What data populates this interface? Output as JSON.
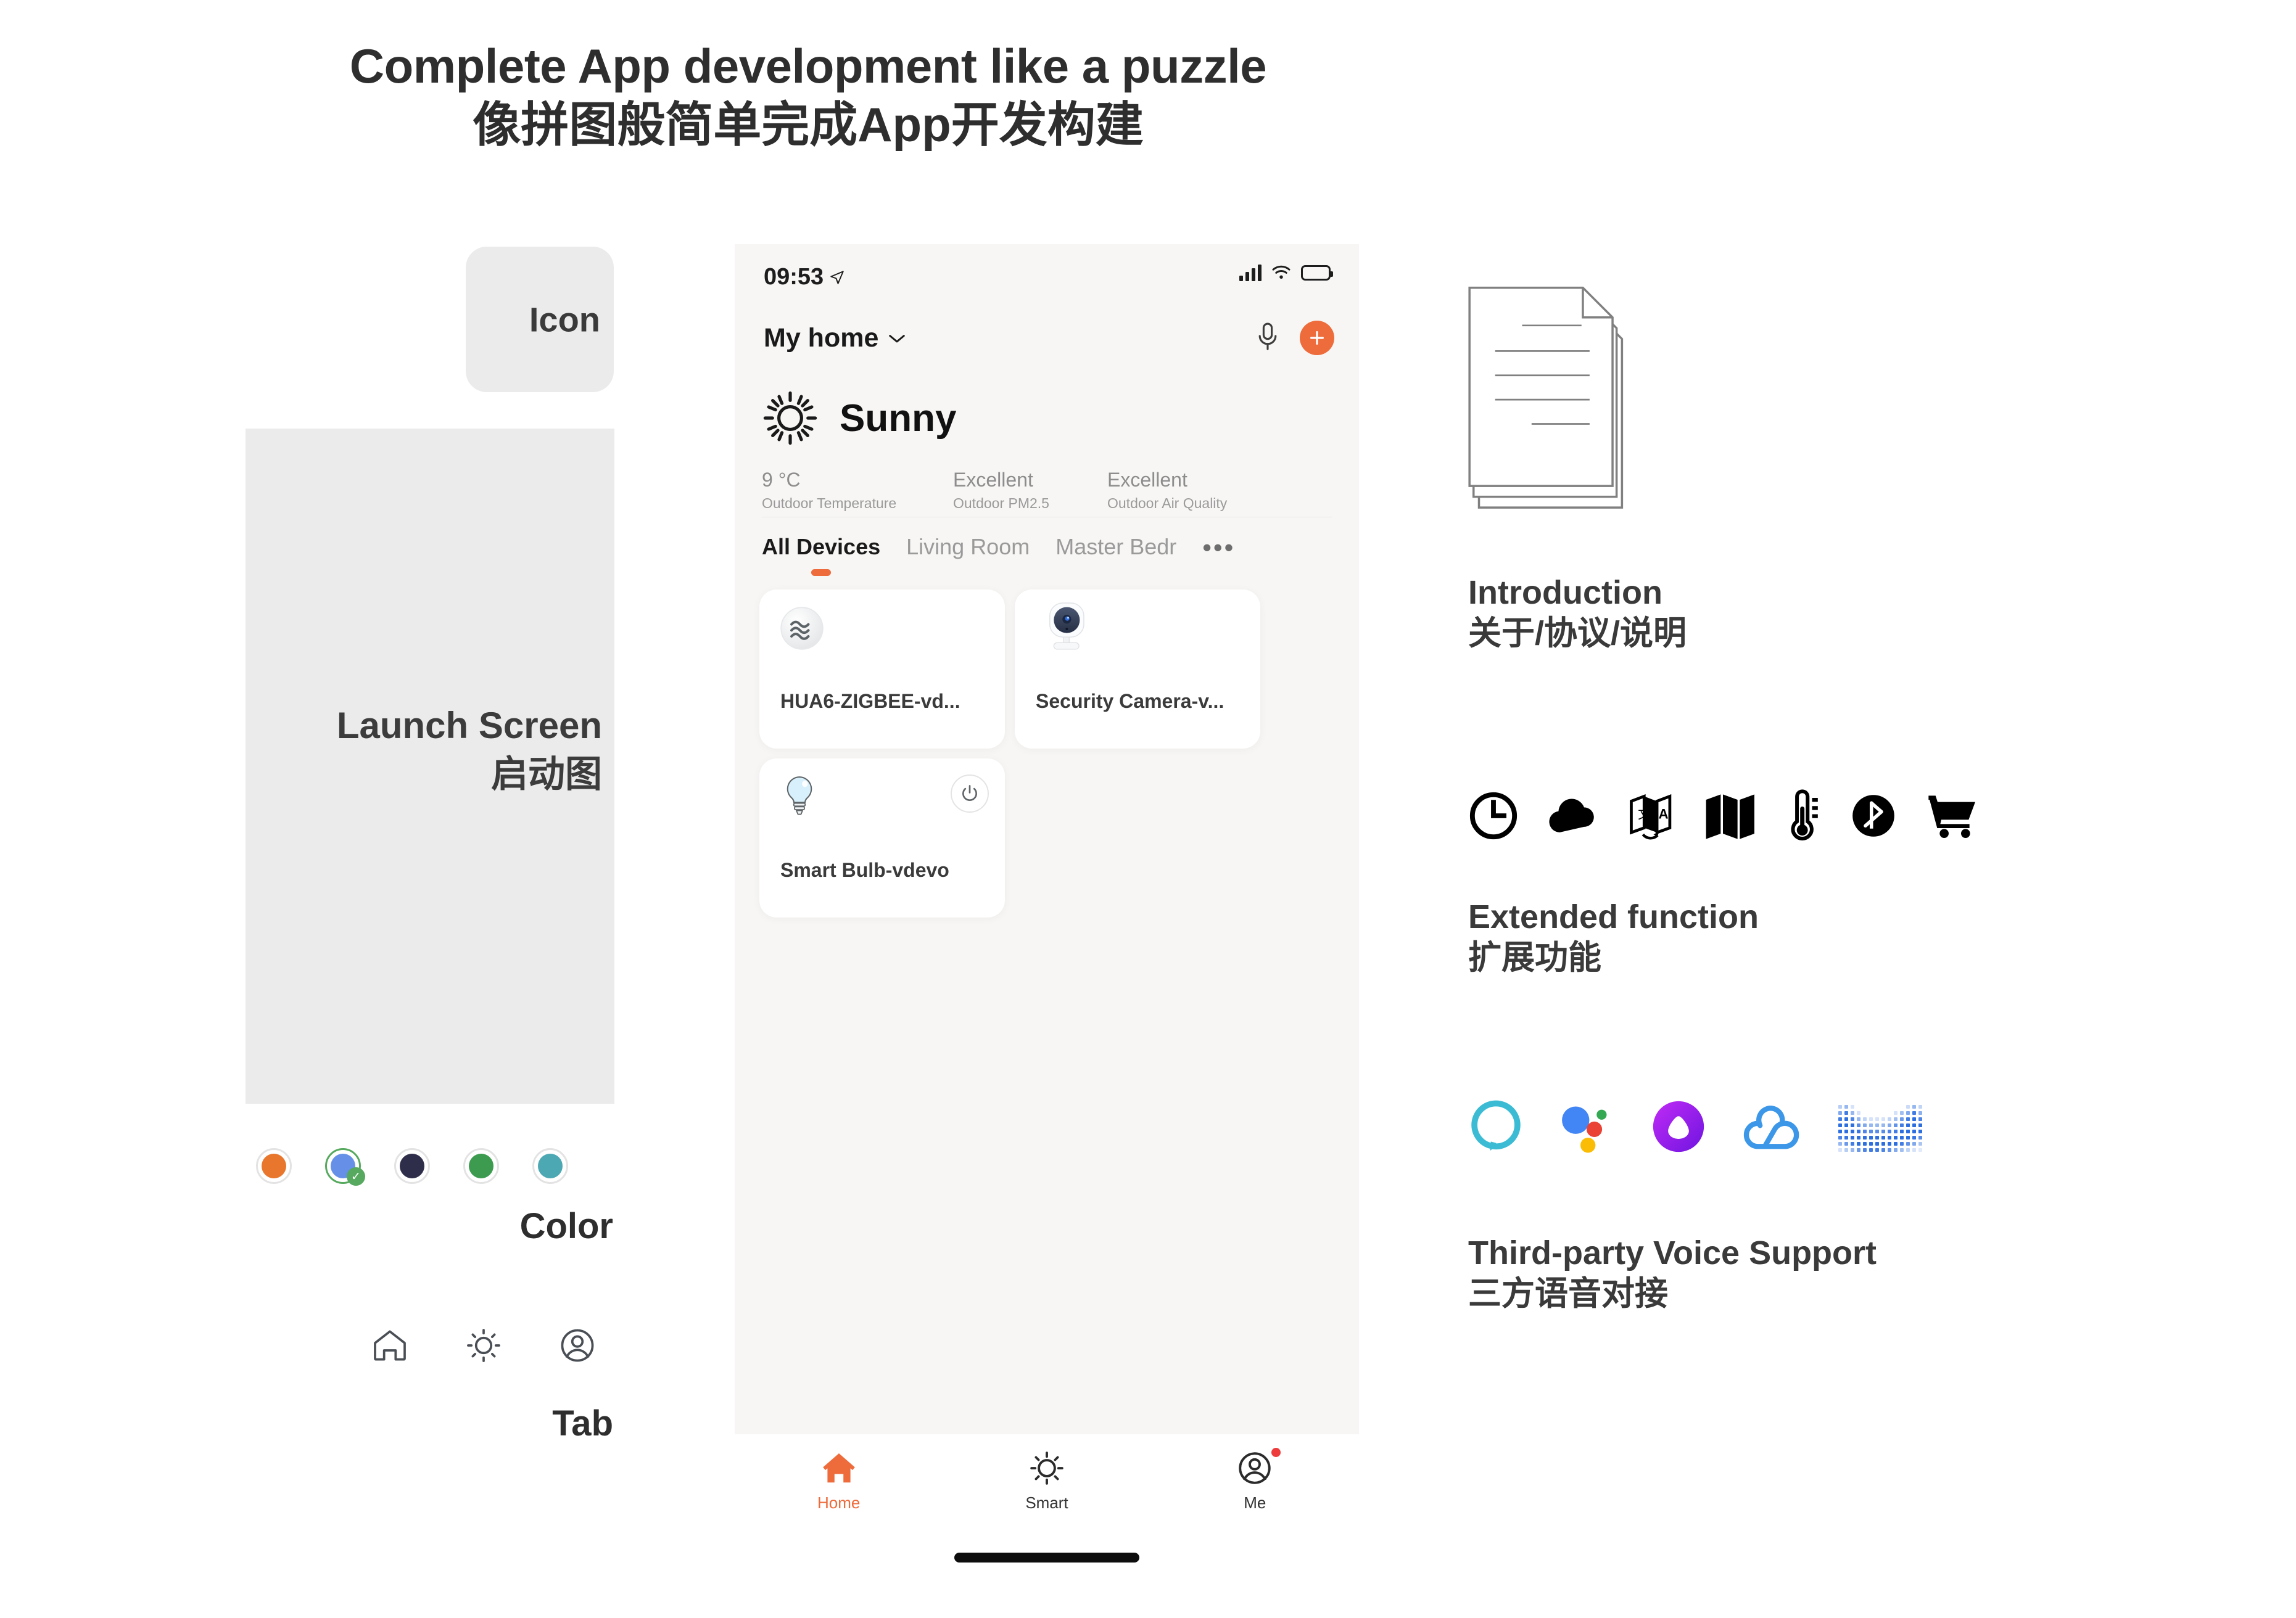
{
  "heading": {
    "en": "Complete App development like a puzzle",
    "zh": "像拼图般简单完成App开发构建"
  },
  "left": {
    "icon_box_label": "Icon",
    "launch_screen_en": "Launch Screen",
    "launch_screen_zh": "启动图",
    "color_label": "Color",
    "tab_label": "Tab",
    "swatches": [
      {
        "name": "orange",
        "hex": "#E8762C",
        "selected": false
      },
      {
        "name": "blue",
        "hex": "#6690E8",
        "selected": true
      },
      {
        "name": "dark-navy",
        "hex": "#2E2E4A",
        "selected": false
      },
      {
        "name": "green",
        "hex": "#3C9B4F",
        "selected": false
      },
      {
        "name": "teal",
        "hex": "#4CA8B3",
        "selected": false
      }
    ],
    "tab_icons": [
      "home-icon",
      "brightness-icon",
      "account-icon"
    ]
  },
  "phone": {
    "status": {
      "time": "09:53",
      "location_icon": "location-arrow-icon",
      "signal_icon": "cellular-signal-icon",
      "wifi_icon": "wifi-icon",
      "battery_icon": "battery-icon"
    },
    "header": {
      "home_name": "My home",
      "chevron": "⌄",
      "mic_icon": "microphone-icon",
      "add_label": "+"
    },
    "weather": {
      "condition": "Sunny",
      "icon": "sun-icon",
      "stats": [
        {
          "value": "9 °C",
          "label": "Outdoor Temperature"
        },
        {
          "value": "Excellent",
          "label": "Outdoor PM2.5"
        },
        {
          "value": "Excellent",
          "label": "Outdoor Air Quality"
        }
      ]
    },
    "tabs": [
      {
        "label": "All Devices",
        "active": true
      },
      {
        "label": "Living Room",
        "active": false
      },
      {
        "label": "Master Bedroom",
        "active": false
      }
    ],
    "tabs_more": "•••",
    "devices": [
      {
        "name": "HUA6-ZIGBEE-vd...",
        "icon": "water-sensor-icon",
        "has_power": false
      },
      {
        "name": "Security Camera-v...",
        "icon": "security-camera-icon",
        "has_power": false
      },
      {
        "name": "Smart Bulb-vdevo",
        "icon": "light-bulb-icon",
        "has_power": true,
        "power_icon": "power-icon"
      }
    ],
    "bottom_nav": [
      {
        "label": "Home",
        "icon": "home-filled-icon",
        "active": true,
        "badge": false
      },
      {
        "label": "Smart",
        "icon": "brightness-icon",
        "active": false,
        "badge": false
      },
      {
        "label": "Me",
        "icon": "account-icon",
        "active": false,
        "badge": true
      }
    ],
    "accent_color": "#EE6B3B",
    "screen_bg": "#F7F6F4"
  },
  "right": {
    "intro": {
      "icon": "document-stack-icon",
      "en": "Introduction",
      "zh": "关于/协议/说明"
    },
    "extended": {
      "en": "Extended function",
      "zh": "扩展功能",
      "icons": [
        "clock-icon",
        "cloud-icon",
        "translate-icon",
        "map-icon",
        "thermometer-icon",
        "bluetooth-icon",
        "shopping-cart-icon"
      ]
    },
    "voice": {
      "en": "Third-party Voice Support",
      "zh": "三方语音对接",
      "logos": [
        {
          "name": "alexa-logo",
          "color": "#3CBCD4"
        },
        {
          "name": "google-assistant-logo",
          "colors": [
            "#4285F4",
            "#EA4335",
            "#FBBC05",
            "#34A853"
          ]
        },
        {
          "name": "siri-logo",
          "colors": [
            "#B428F0",
            "#7A1DE8"
          ]
        },
        {
          "name": "alibaba-genie-logo",
          "color": "#3C97E8"
        },
        {
          "name": "xiaoai-logo",
          "color": "#2E6FE0"
        }
      ]
    }
  }
}
